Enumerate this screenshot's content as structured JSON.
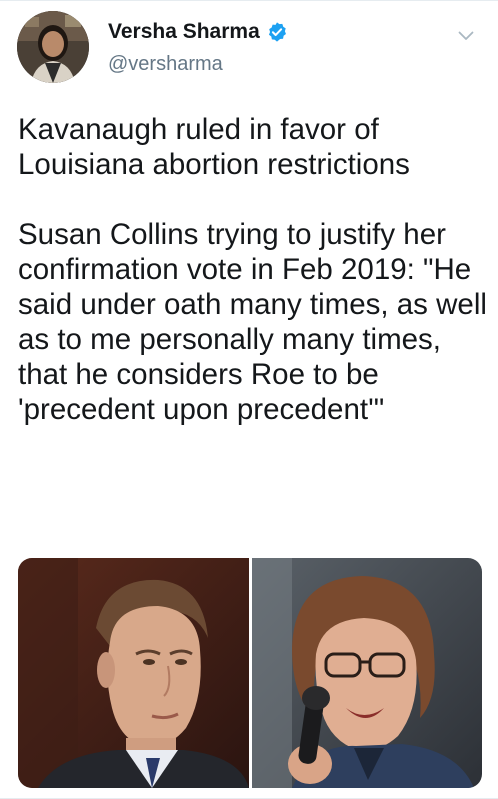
{
  "tweet": {
    "author": {
      "display_name": "Versha Sharma",
      "handle": "@versharma",
      "verified": true,
      "avatar_icon": "profile-avatar"
    },
    "menu_icon": "chevron-down-icon",
    "paragraphs": [
      "Kavanaugh ruled in favor of Louisiana abortion restrictions",
      "Susan Collins trying to justify her confirmation vote in Feb 2019: \"He said under oath many times, as well as to me personally many times, that he considers Roe to be 'precedent upon precedent'\""
    ],
    "media": [
      {
        "kind": "photo",
        "subject": "man-in-suit-portrait"
      },
      {
        "kind": "photo",
        "subject": "woman-speaking-at-microphone"
      }
    ]
  },
  "colors": {
    "text_primary": "#14171a",
    "text_secondary": "#657786",
    "verified_blue": "#1da1f2",
    "divider": "#e6ecf0"
  }
}
